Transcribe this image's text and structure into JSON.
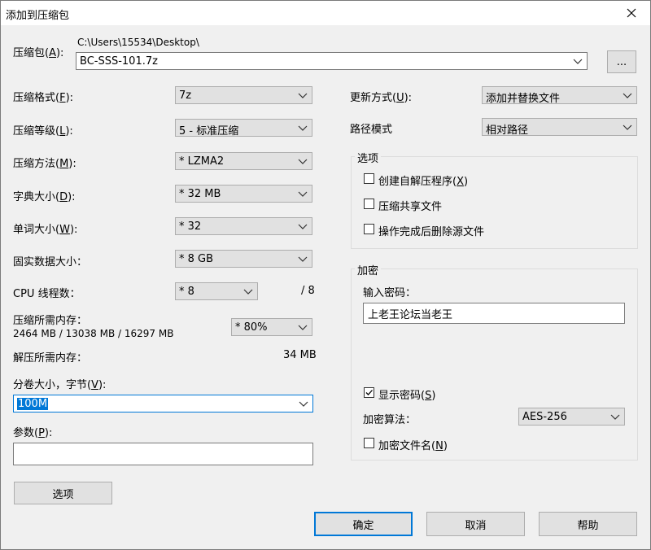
{
  "window": {
    "title": "添加到压缩包"
  },
  "archive": {
    "label": "压缩包(",
    "key": "A",
    "label_end": "):",
    "path": "C:\\Users\\15534\\Desktop\\",
    "filename": "BC-SSS-101.7z",
    "browse_label": "..."
  },
  "left": {
    "format": {
      "label": "压缩格式(",
      "key": "F",
      "end": "):",
      "value": "7z"
    },
    "level": {
      "label": "压缩等级(",
      "key": "L",
      "end": "):",
      "value": "5 - 标准压缩"
    },
    "method": {
      "label": "压缩方法(",
      "key": "M",
      "end": "):",
      "value": "* LZMA2"
    },
    "dict": {
      "label": "字典大小(",
      "key": "D",
      "end": "):",
      "value": "* 32 MB"
    },
    "word": {
      "label": "单词大小(",
      "key": "W",
      "end": "):",
      "value": "* 32"
    },
    "solid": {
      "label": "固实数据大小：",
      "value": "* 8 GB"
    },
    "threads": {
      "label": "CPU 线程数：",
      "value": "* 8",
      "total": "/ 8"
    },
    "mem_compress": {
      "label": "压缩所需内存：",
      "detail": "2464 MB / 13038 MB / 16297 MB",
      "value": "* 80%"
    },
    "mem_decompress": {
      "label": "解压所需内存：",
      "value": "34 MB"
    },
    "volume": {
      "label": "分卷大小，字节(",
      "key": "V",
      "end": "):",
      "value": "100M"
    },
    "params": {
      "label": "参数(",
      "key": "P",
      "end": "):",
      "value": ""
    },
    "options_button": "选项"
  },
  "right": {
    "update": {
      "label": "更新方式(",
      "key": "U",
      "end": "):",
      "value": "添加并替换文件"
    },
    "path_mode": {
      "label": "路径模式",
      "value": "相对路径"
    },
    "options": {
      "title": "选项",
      "sfx": {
        "label": "创建自解压程序(",
        "key": "X",
        "end": ")",
        "checked": false
      },
      "shared": {
        "label": "压缩共享文件",
        "checked": false
      },
      "delete": {
        "label": "操作完成后删除源文件",
        "checked": false
      }
    },
    "encryption": {
      "title": "加密",
      "password_label": "输入密码：",
      "password_value": "上老王论坛当老王",
      "show_password": {
        "label": "显示密码(",
        "key": "S",
        "end": ")",
        "checked": true
      },
      "method_label": "加密算法：",
      "method_value": "AES-256",
      "encrypt_names": {
        "label": "加密文件名(",
        "key": "N",
        "end": ")",
        "checked": false
      }
    }
  },
  "buttons": {
    "ok": "确定",
    "cancel": "取消",
    "help": "帮助"
  }
}
